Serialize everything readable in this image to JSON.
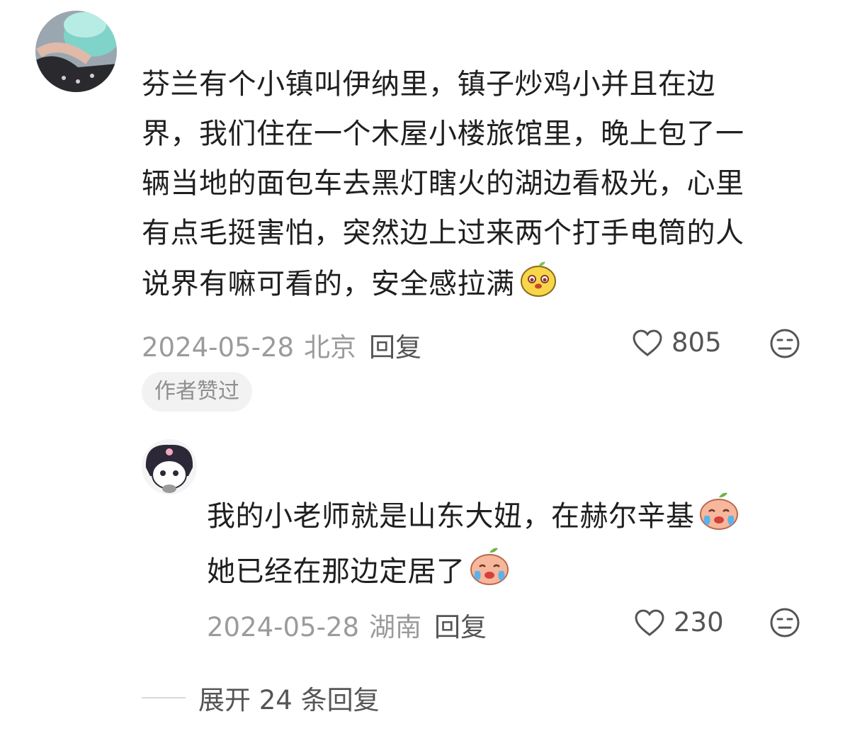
{
  "main_comment": {
    "lines": [
      "芬兰有个小镇叫伊纳里，镇子炒鸡小并且在边",
      "界，我们住在一个木屋小楼旅馆里，晚上包了一",
      "辆当地的面包车去黑灯瞎火的湖边看极光，心里",
      "有点毛挺害怕，突然边上过来两个打手电筒的人",
      "说界有嘛可看的，安全感拉满"
    ],
    "emoji": "smiling-mango-emoji",
    "date": "2024-05-28",
    "location": "北京",
    "reply_label": "回复",
    "likes": "805",
    "author_liked_badge": "作者赞过"
  },
  "reply_comment": {
    "lines": [
      "我的小老师就是山东大妞，在赫尔辛基",
      "她已经在那边定居了"
    ],
    "emoji": "crying-peach-emoji",
    "date": "2024-05-28",
    "location": "湖南",
    "reply_label": "回复",
    "likes": "230"
  },
  "expand_replies": "展开 24 条回复",
  "colors": {
    "text": "#1f1f1f",
    "meta": "#9b9b9b",
    "action": "#555555",
    "badge_bg": "#f2f2f2"
  }
}
